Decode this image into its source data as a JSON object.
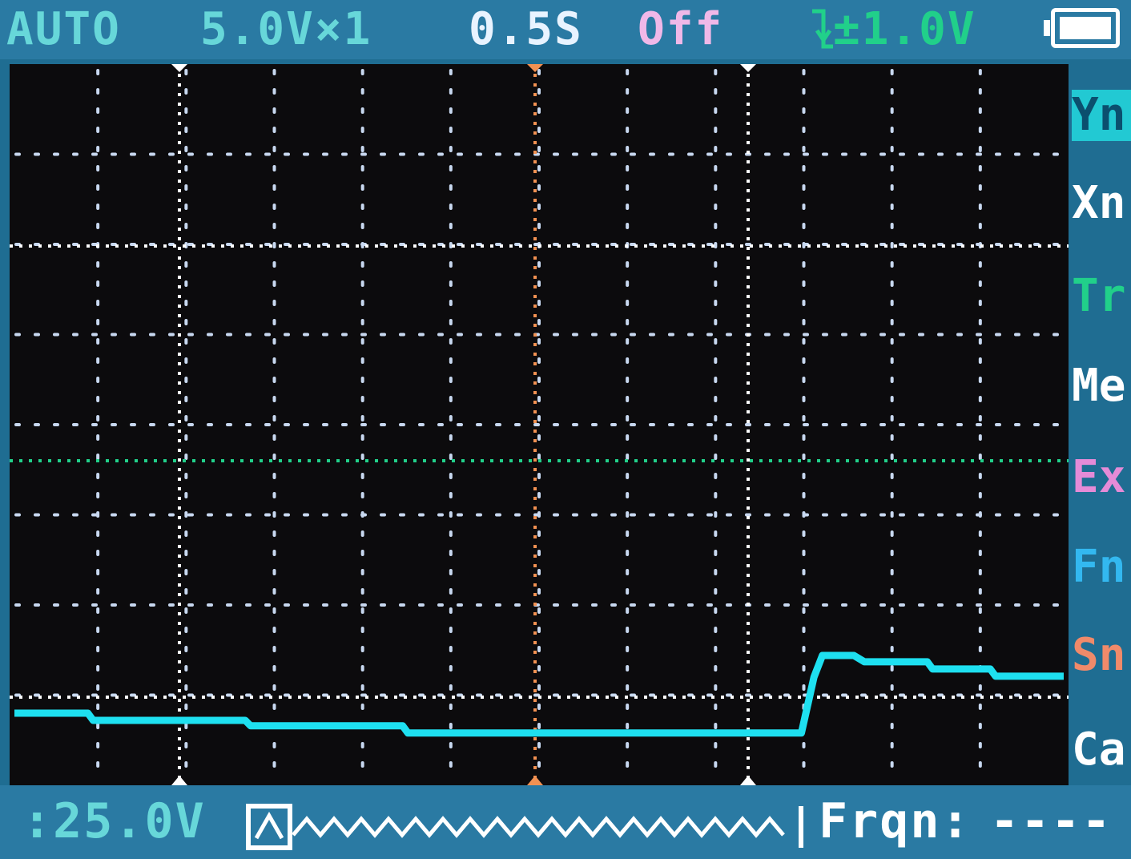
{
  "status": {
    "mode": "AUTO",
    "vertical_scale": "5.0V×1",
    "timebase": "0.5S",
    "coupling": "Off",
    "trigger_level": "±1.0V",
    "trigger_icon": "falling-edge-trigger-icon",
    "battery_icon": "battery-full-icon"
  },
  "menu": {
    "items": [
      {
        "label": "Yn",
        "color": "#22c9d3",
        "active": true
      },
      {
        "label": "Xn",
        "color": "#ffffff",
        "active": false
      },
      {
        "label": "Tr",
        "color": "#21d08a",
        "active": false
      },
      {
        "label": "Me",
        "color": "#ffffff",
        "active": false
      },
      {
        "label": "Ex",
        "color": "#e58bd7",
        "active": false
      },
      {
        "label": "Fn",
        "color": "#33b8f0",
        "active": false
      },
      {
        "label": "Sn",
        "color": "#f08a6a",
        "active": false
      },
      {
        "label": "Ca",
        "color": "#ffffff",
        "active": false
      }
    ]
  },
  "bottom": {
    "cursor_value": ":25.0V",
    "trigger_wave_icon": "square-wave-generator-icon",
    "frequency_label": "Frqn:",
    "frequency_value": "----"
  },
  "colors": {
    "accent_cyan": "#22c9d3",
    "trigger_green": "#21d08a",
    "time_cursor_orange": "#f29152",
    "status_text_cyan": "#67d7d9",
    "status_text_white": "#e8f3ff",
    "waveform": "#1ee0f0",
    "grid_dots": "#c8d8f0"
  },
  "waveform": {
    "samples": [
      [
        0.0,
        -3.2
      ],
      [
        0.07,
        -3.2
      ],
      [
        0.075,
        -3.28
      ],
      [
        0.22,
        -3.28
      ],
      [
        0.225,
        -3.34
      ],
      [
        0.37,
        -3.34
      ],
      [
        0.375,
        -3.42
      ],
      [
        0.52,
        -3.42
      ],
      [
        0.7,
        -3.42
      ],
      [
        0.75,
        -3.42
      ],
      [
        0.762,
        -2.8
      ],
      [
        0.77,
        -2.56
      ],
      [
        0.8,
        -2.56
      ],
      [
        0.81,
        -2.63
      ],
      [
        0.87,
        -2.63
      ],
      [
        0.875,
        -2.71
      ],
      [
        0.93,
        -2.71
      ],
      [
        0.935,
        -2.79
      ],
      [
        1.0,
        -2.79
      ]
    ],
    "y_range": [
      -4,
      4
    ]
  }
}
